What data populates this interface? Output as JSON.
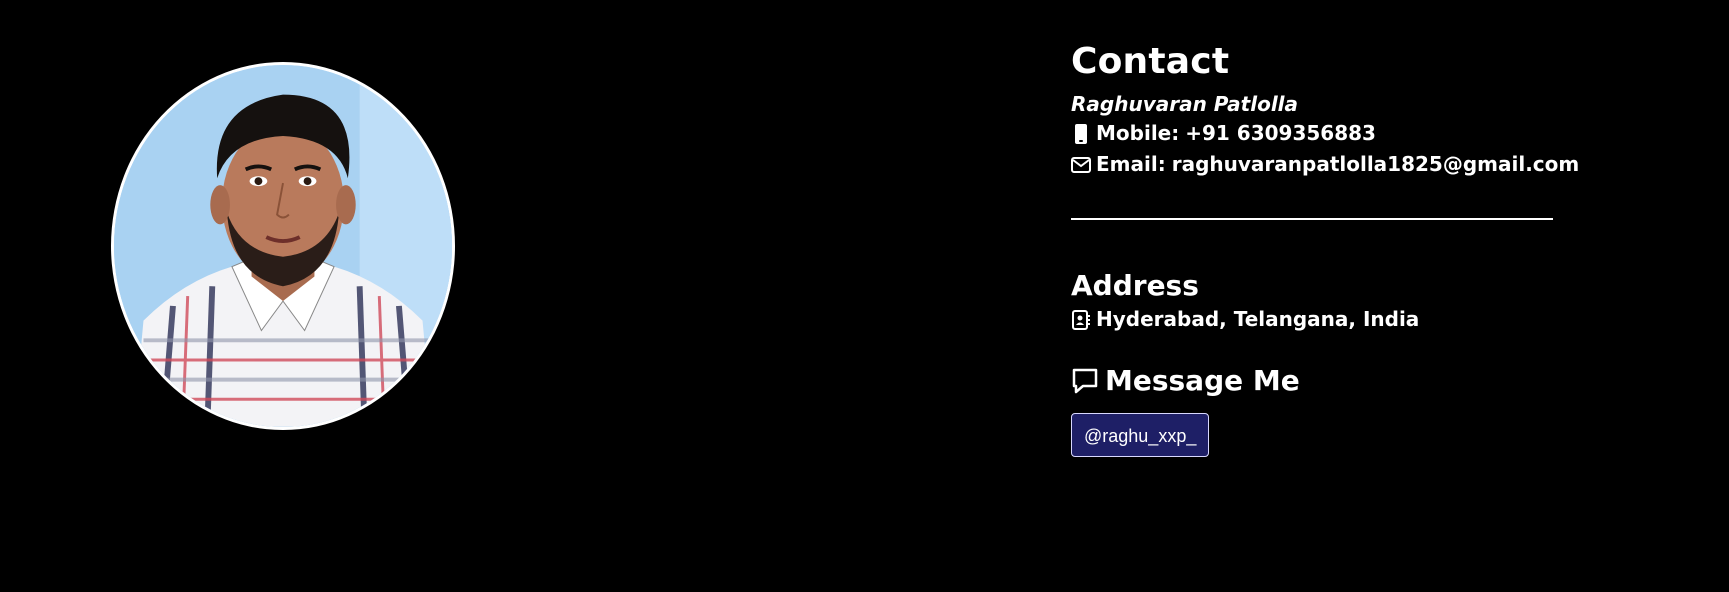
{
  "profile": {
    "photo_alt": "Profile photo"
  },
  "contact": {
    "heading": "Contact",
    "name": "Raghuvaran Patlolla",
    "mobile": {
      "icon": "mobile-phone-icon",
      "label": "Mobile:",
      "value": "+91 6309356883"
    },
    "email": {
      "icon": "envelope-icon",
      "label": "Email:",
      "value": "raghuvaranpatlolla1825@gmail.com"
    }
  },
  "address": {
    "heading": "Address",
    "icon": "address-book-icon",
    "value": "Hyderabad, Telangana, India"
  },
  "message": {
    "icon": "speech-bubble-icon",
    "heading": "Message Me",
    "handle": "@raghu_xxp_"
  },
  "colors": {
    "background": "#000000",
    "text": "#ffffff",
    "button_bg": "#1e1f66",
    "photo_bg": "#a9d2f2"
  }
}
